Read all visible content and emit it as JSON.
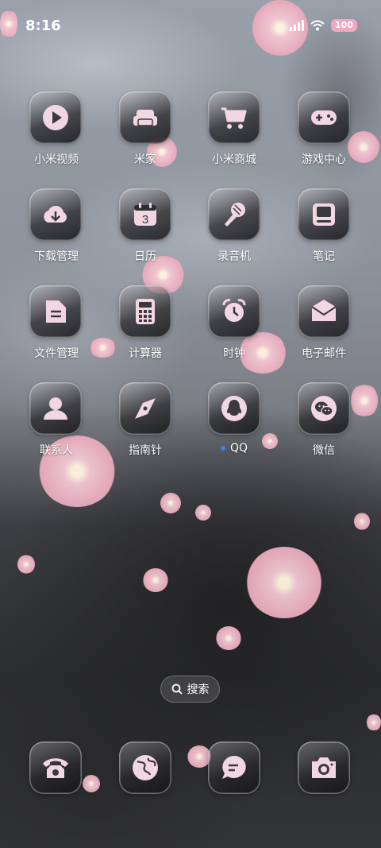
{
  "status": {
    "time": "8:16",
    "battery": "100"
  },
  "apps": [
    {
      "label": "小米视频",
      "icon": "video-play-icon"
    },
    {
      "label": "米家",
      "icon": "sofa-icon"
    },
    {
      "label": "小米商城",
      "icon": "cart-icon"
    },
    {
      "label": "游戏中心",
      "icon": "gamepad-icon"
    },
    {
      "label": "下载管理",
      "icon": "cloud-download-icon"
    },
    {
      "label": "日历",
      "icon": "calendar-icon",
      "date": "3"
    },
    {
      "label": "录音机",
      "icon": "microphone-icon"
    },
    {
      "label": "笔记",
      "icon": "notes-icon"
    },
    {
      "label": "文件管理",
      "icon": "document-icon"
    },
    {
      "label": "计算器",
      "icon": "calculator-icon"
    },
    {
      "label": "时钟",
      "icon": "alarm-clock-icon"
    },
    {
      "label": "电子邮件",
      "icon": "envelope-icon"
    },
    {
      "label": "联系人",
      "icon": "person-icon"
    },
    {
      "label": "指南针",
      "icon": "compass-icon"
    },
    {
      "label": "QQ",
      "icon": "penguin-icon",
      "new_indicator": true
    },
    {
      "label": "微信",
      "icon": "wechat-icon"
    }
  ],
  "search": {
    "label": "搜索"
  },
  "dock": [
    {
      "icon": "telephone-icon"
    },
    {
      "icon": "browser-globe-icon"
    },
    {
      "icon": "message-bubble-icon"
    },
    {
      "icon": "camera-icon"
    }
  ],
  "colors": {
    "icon_glyph": "#f2d6e2",
    "accent_dot": "#3b82f6",
    "battery": "#f0a8c0"
  }
}
